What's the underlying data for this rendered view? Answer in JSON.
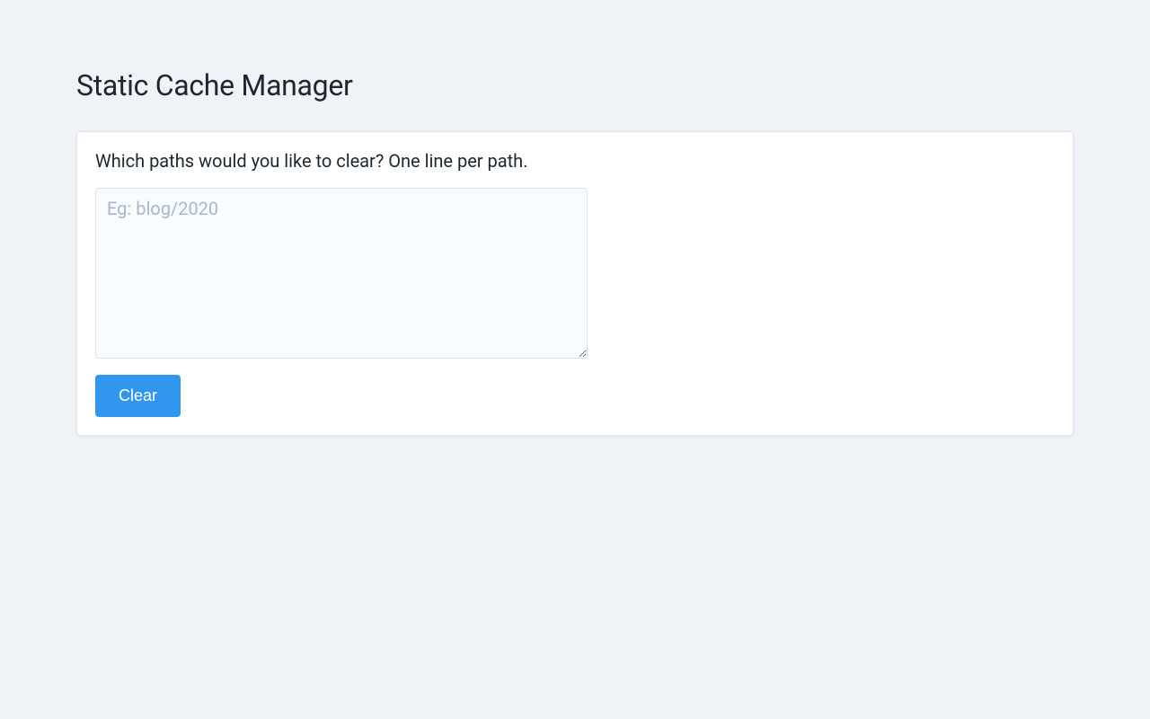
{
  "page": {
    "title": "Static Cache Manager"
  },
  "card": {
    "label": "Which paths would you like to clear? One line per path.",
    "textarea_placeholder": "Eg: blog/2020",
    "textarea_value": "",
    "button_label": "Clear"
  }
}
